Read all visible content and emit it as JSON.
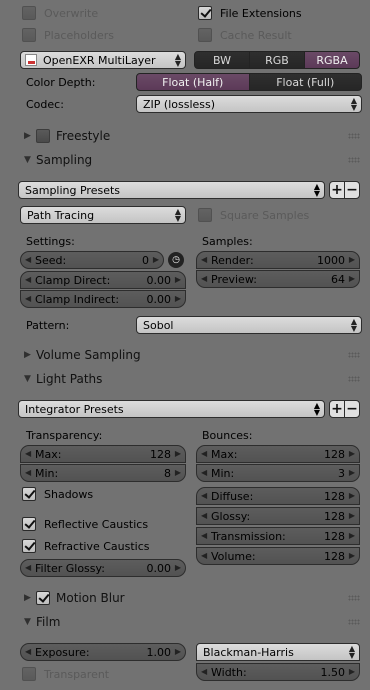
{
  "output": {
    "overwrite": "Overwrite",
    "placeholders": "Placeholders",
    "file_extensions": "File Extensions",
    "cache_result": "Cache Result",
    "format": "OpenEXR MultiLayer",
    "color_modes": [
      "BW",
      "RGB",
      "RGBA"
    ],
    "color_mode_selected": "RGBA",
    "color_depth_label": "Color Depth:",
    "color_depth_options": [
      "Float (Half)",
      "Float (Full)"
    ],
    "color_depth_selected": "Float (Half)",
    "codec_label": "Codec:",
    "codec": "ZIP (lossless)"
  },
  "panels": {
    "freestyle": "Freestyle",
    "sampling": "Sampling",
    "volume_sampling": "Volume Sampling",
    "light_paths": "Light Paths",
    "motion_blur": "Motion Blur",
    "film": "Film"
  },
  "sampling": {
    "presets": "Sampling Presets",
    "method": "Path Tracing",
    "square_samples": "Square Samples",
    "settings_label": "Settings:",
    "samples_label": "Samples:",
    "seed_label": "Seed:",
    "seed_value": "0",
    "clamp_direct_label": "Clamp Direct:",
    "clamp_direct_value": "0.00",
    "clamp_indirect_label": "Clamp Indirect:",
    "clamp_indirect_value": "0.00",
    "render_label": "Render:",
    "render_value": "1000",
    "preview_label": "Preview:",
    "preview_value": "64",
    "pattern_label": "Pattern:",
    "pattern": "Sobol"
  },
  "light_paths": {
    "presets": "Integrator Presets",
    "transparency_label": "Transparency:",
    "bounces_label": "Bounces:",
    "t_max_label": "Max:",
    "t_max_value": "128",
    "t_min_label": "Min:",
    "t_min_value": "8",
    "b_max_label": "Max:",
    "b_max_value": "128",
    "b_min_label": "Min:",
    "b_min_value": "3",
    "shadows": "Shadows",
    "reflective_caustics": "Reflective Caustics",
    "refractive_caustics": "Refractive Caustics",
    "filter_glossy_label": "Filter Glossy:",
    "filter_glossy_value": "0.00",
    "diffuse_label": "Diffuse:",
    "diffuse_value": "128",
    "glossy_label": "Glossy:",
    "glossy_value": "128",
    "transmission_label": "Transmission:",
    "transmission_value": "128",
    "volume_label": "Volume:",
    "volume_value": "128"
  },
  "film": {
    "exposure_label": "Exposure:",
    "exposure_value": "1.00",
    "filter": "Blackman-Harris",
    "transparent": "Transparent",
    "width_label": "Width:",
    "width_value": "1.50"
  },
  "colors": {
    "accent": "#5c3a58",
    "panel_bg": "#727272"
  }
}
